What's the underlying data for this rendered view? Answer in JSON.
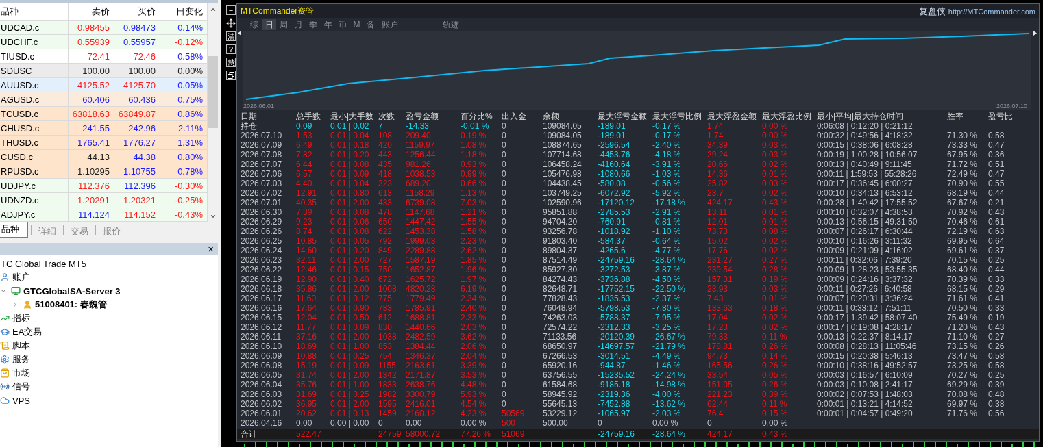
{
  "market_watch": {
    "columns": [
      "品种",
      "卖价",
      "买价",
      "日变化"
    ],
    "rows": [
      {
        "symbol": "UDCAD.c",
        "color": "#effbef",
        "bid": {
          "value": "0.98455",
          "kind": "down"
        },
        "ask": {
          "value": "0.98473",
          "kind": "up"
        },
        "change": {
          "value": "0.14%",
          "kind": "up"
        }
      },
      {
        "symbol": "UDCHF.c",
        "color": "#effbef",
        "bid": {
          "value": "0.55939",
          "kind": "down"
        },
        "ask": {
          "value": "0.55957",
          "kind": "up"
        },
        "change": {
          "value": "-0.12%",
          "kind": "down"
        }
      },
      {
        "symbol": "TIUSD.c",
        "color": "#ffffff",
        "bid": {
          "value": "72.41",
          "kind": "down"
        },
        "ask": {
          "value": "72.46",
          "kind": "down"
        },
        "change": {
          "value": "0.58%",
          "kind": "up"
        }
      },
      {
        "symbol": "SDUSC",
        "color": "#ebebeb",
        "bid": {
          "value": "100.00",
          "kind": "flat"
        },
        "ask": {
          "value": "100.00",
          "kind": "flat"
        },
        "change": {
          "value": "0.00%",
          "kind": "flat"
        }
      },
      {
        "symbol": "AUUSD.c",
        "color": "#e3effb",
        "bid": {
          "value": "4125.52",
          "kind": "down"
        },
        "ask": {
          "value": "4125.70",
          "kind": "down"
        },
        "change": {
          "value": "0.05%",
          "kind": "up"
        }
      },
      {
        "symbol": "AGUSD.c",
        "color": "#fbebdc",
        "bid": {
          "value": "60.406",
          "kind": "up"
        },
        "ask": {
          "value": "60.436",
          "kind": "up"
        },
        "change": {
          "value": "0.75%",
          "kind": "up"
        }
      },
      {
        "symbol": "TCUSD.c",
        "color": "#fde4ca",
        "bid": {
          "value": "63818.63",
          "kind": "down"
        },
        "ask": {
          "value": "63849.87",
          "kind": "down"
        },
        "change": {
          "value": "0.86%",
          "kind": "up"
        }
      },
      {
        "symbol": "CHUSD.c",
        "color": "#fde4ca",
        "bid": {
          "value": "241.55",
          "kind": "up"
        },
        "ask": {
          "value": "242.96",
          "kind": "up"
        },
        "change": {
          "value": "2.11%",
          "kind": "up"
        }
      },
      {
        "symbol": "THUSD.c",
        "color": "#fde4ca",
        "bid": {
          "value": "1765.41",
          "kind": "up"
        },
        "ask": {
          "value": "1776.27",
          "kind": "up"
        },
        "change": {
          "value": "1.31%",
          "kind": "up"
        }
      },
      {
        "symbol": "CUSD.c",
        "color": "#fde4ca",
        "bid": {
          "value": "44.13",
          "kind": "flat"
        },
        "ask": {
          "value": "44.38",
          "kind": "up"
        },
        "change": {
          "value": "0.80%",
          "kind": "up"
        }
      },
      {
        "symbol": "RPUSD.c",
        "color": "#fde4ca",
        "bid": {
          "value": "1.10295",
          "kind": "flat"
        },
        "ask": {
          "value": "1.10755",
          "kind": "up"
        },
        "change": {
          "value": "0.78%",
          "kind": "up"
        }
      },
      {
        "symbol": "UDJPY.c",
        "color": "#effbef",
        "bid": {
          "value": "112.376",
          "kind": "down"
        },
        "ask": {
          "value": "112.396",
          "kind": "up"
        },
        "change": {
          "value": "-0.30%",
          "kind": "down"
        }
      },
      {
        "symbol": "UDNZD.c",
        "color": "#effbef",
        "bid": {
          "value": "1.20291",
          "kind": "down"
        },
        "ask": {
          "value": "1.20321",
          "kind": "down"
        },
        "change": {
          "value": "-0.25%",
          "kind": "down"
        }
      },
      {
        "symbol": "ADJPY.c",
        "color": "#effbef",
        "bid": {
          "value": "114.124",
          "kind": "up"
        },
        "ask": {
          "value": "114.152",
          "kind": "down"
        },
        "change": {
          "value": "-0.43%",
          "kind": "down"
        }
      }
    ],
    "tabs": [
      {
        "label": "品种",
        "selected": true
      },
      {
        "label": "详细",
        "selected": false
      },
      {
        "label": "交易",
        "selected": false
      },
      {
        "label": "报价",
        "selected": false
      }
    ]
  },
  "navigator": {
    "close": "×",
    "tree": [
      {
        "label": "TC Global Trade MT5",
        "children": [
          {
            "label": "账户",
            "kind": "accounts",
            "children": [
              {
                "label": "GTCGlobalSA-Server 3",
                "kind": "server",
                "expanded": true,
                "children": [
                  {
                    "label": "51008401: 春魏管",
                    "kind": "account",
                    "expanded": false
                  }
                ]
              }
            ]
          },
          {
            "label": "指标",
            "kind": "indicators"
          },
          {
            "label": "EA交易",
            "kind": "experts"
          },
          {
            "label": "脚本",
            "kind": "scripts"
          },
          {
            "label": "服务",
            "kind": "services"
          },
          {
            "label": "市场",
            "kind": "market"
          },
          {
            "label": "信号",
            "kind": "signals"
          },
          {
            "label": "VPS",
            "kind": "vps"
          }
        ]
      }
    ]
  },
  "commander": {
    "tools": [
      {
        "kind": "minimize",
        "label": "−"
      },
      {
        "kind": "move"
      },
      {
        "kind": "text",
        "label": "清"
      },
      {
        "kind": "help",
        "label": "?"
      },
      {
        "kind": "text",
        "label": "慧"
      },
      {
        "kind": "restore"
      }
    ],
    "title": "MTCommander资管",
    "brand": "复盘侠",
    "url": "http://MTCommander.com",
    "tabs": [
      {
        "label": "综",
        "selected": false
      },
      {
        "label": "日",
        "selected": true
      },
      {
        "label": "周",
        "selected": false
      },
      {
        "label": "月",
        "selected": false
      },
      {
        "label": "季",
        "selected": false
      },
      {
        "label": "年",
        "selected": false
      },
      {
        "label": "币",
        "selected": false
      },
      {
        "label": "M",
        "selected": false
      },
      {
        "label": "备",
        "selected": false
      },
      {
        "label": "账户",
        "selected": false
      }
    ],
    "mode_tabs": [
      {
        "label": "轨迹",
        "selected": false
      }
    ],
    "chart": {
      "start_label": "2026.06.01",
      "end_label": "2026.07.10"
    },
    "table": {
      "columns": [
        {
          "label": "日期",
          "kind": "date"
        },
        {
          "label": "总手数",
          "kind": "trade"
        },
        {
          "label": "最小|大手数",
          "kind": "trade"
        },
        {
          "label": "次数",
          "kind": "trade"
        },
        {
          "label": "盈亏金额",
          "kind": "trade"
        },
        {
          "label": "百分比%",
          "kind": "trade"
        },
        {
          "label": "出入金",
          "kind": "cash"
        },
        {
          "label": "余额",
          "kind": "balance"
        },
        {
          "label": "最大浮亏金额",
          "kind": "drawdown"
        },
        {
          "label": "最大浮亏比例",
          "kind": "drawdown"
        },
        {
          "label": "最大浮盈金额",
          "kind": "runup"
        },
        {
          "label": "最大浮盈比例",
          "kind": "runup"
        },
        {
          "label": "最小|平均|最大持仓时间",
          "kind": "stat"
        },
        {
          "label": "胜率",
          "kind": "stat"
        },
        {
          "label": "盈亏比",
          "kind": "stat"
        }
      ],
      "rows": [
        {
          "kind": "open",
          "cash_flow": false,
          "cells": [
            "持仓",
            "0.09",
            "0.01 | 0.02",
            "7",
            "-14.33",
            "-0.01 %",
            "0",
            "109084.05",
            "-189.01",
            "-0.17 %",
            "1.74",
            "0.00 %",
            "0:06:08 | 0:12:20 | 0:21:12",
            null,
            null
          ]
        },
        {
          "kind": "gain",
          "cash_flow": false,
          "cells": [
            "2026.07.10",
            "1.53",
            "0.01 | 0.04",
            "108",
            "209.40",
            "0.19 %",
            "0",
            "109084.05",
            "-189.01",
            "-0.17 %",
            "1.74",
            "0.00 %",
            "0:00:32 | 0:49:56 | 4:18:32",
            "71.30 %",
            "0.58"
          ]
        },
        {
          "kind": "gain",
          "cash_flow": false,
          "cells": [
            "2026.07.09",
            "6.49",
            "0.01 | 0.18",
            "420",
            "1159.97",
            "1.08 %",
            "0",
            "108874.65",
            "-2596.54",
            "-2.40 %",
            "34.39",
            "0.03 %",
            "0:00:15 | 0:38:06 | 6:08:28",
            "73.33 %",
            "0.47"
          ]
        },
        {
          "kind": "gain",
          "cash_flow": false,
          "cells": [
            "2026.07.08",
            "7.82",
            "0.01 | 0.20",
            "443",
            "1256.44",
            "1.18 %",
            "0",
            "107714.68",
            "-4453.76",
            "-4.18 %",
            "29.24",
            "0.03 %",
            "0:00:19 | 1:00:28 | 10:56:07",
            "67.95 %",
            "0.36"
          ]
        },
        {
          "kind": "gain",
          "cash_flow": false,
          "cells": [
            "2026.07.07",
            "6.44",
            "0.01 | 0.08",
            "435",
            "981.26",
            "0.93 %",
            "0",
            "106458.24",
            "-4160.64",
            "-3.91 %",
            "20.66",
            "0.02 %",
            "0:00:13 | 0:40:49 | 9:11:45",
            "71.72 %",
            "0.51"
          ]
        },
        {
          "kind": "gain",
          "cash_flow": false,
          "cells": [
            "2026.07.06",
            "6.57",
            "0.01 | 0.09",
            "418",
            "1038.53",
            "0.99 %",
            "0",
            "105476.98",
            "-1080.66",
            "-1.03 %",
            "14.36",
            "0.01 %",
            "0:00:11 | 1:59:53 | 55:28:26",
            "72.49 %",
            "0.47"
          ]
        },
        {
          "kind": "gain",
          "cash_flow": false,
          "cells": [
            "2026.07.03",
            "4.40",
            "0.01 | 0.04",
            "323",
            "689.20",
            "0.66 %",
            "0",
            "104438.45",
            "-580.08",
            "-0.56 %",
            "25.82",
            "0.03 %",
            "0:00:17 | 0:36:45 | 6:00:27",
            "70.90 %",
            "0.55"
          ]
        },
        {
          "kind": "gain",
          "cash_flow": false,
          "cells": [
            "2026.07.02",
            "12.91",
            "0.01 | 0.80",
            "613",
            "1158.29",
            "1.13 %",
            "0",
            "103749.25",
            "-6072.92",
            "-5.92 %",
            "23.7",
            "0.02 %",
            "0:00:10 | 0:34:13 | 6:53:12",
            "68.19 %",
            "0.44"
          ]
        },
        {
          "kind": "gain",
          "cash_flow": false,
          "cells": [
            "2026.07.01",
            "40.35",
            "0.01 | 2.00",
            "433",
            "6739.08",
            "7.03 %",
            "0",
            "102590.96",
            "-17120.12",
            "-17.18 %",
            "424.17",
            "0.43 %",
            "0:00:28 | 1:40:42 | 17:55:52",
            "67.67 %",
            "0.21"
          ]
        },
        {
          "kind": "gain",
          "cash_flow": false,
          "cells": [
            "2026.06.30",
            "7.39",
            "0.01 | 0.08",
            "478",
            "1147.68",
            "1.21 %",
            "0",
            "95851.88",
            "-2785.53",
            "-2.91 %",
            "13.11",
            "0.01 %",
            "0:00:10 | 0:32:07 | 4:38:53",
            "70.92 %",
            "0.43"
          ]
        },
        {
          "kind": "gain",
          "cash_flow": false,
          "cells": [
            "2026.06.29",
            "9.23",
            "0.01 | 0.06",
            "650",
            "1447.42",
            "1.55 %",
            "0",
            "94704.20",
            "-760.91",
            "-0.81 %",
            "12.01",
            "0.01 %",
            "0:00:13 | 0:56:15 | 49:31:50",
            "70.46 %",
            "0.61"
          ]
        },
        {
          "kind": "gain",
          "cash_flow": false,
          "cells": [
            "2026.06.26",
            "8.74",
            "0.01 | 0.08",
            "622",
            "1453.38",
            "1.58 %",
            "0",
            "93256.78",
            "-1018.92",
            "-1.10 %",
            "73.73",
            "0.08 %",
            "0:00:07 | 0:26:17 | 6:30:44",
            "72.19 %",
            "0.63"
          ]
        },
        {
          "kind": "gain",
          "cash_flow": false,
          "cells": [
            "2026.06.25",
            "10.85",
            "0.01 | 0.05",
            "792",
            "1999.03",
            "2.23 %",
            "0",
            "91803.40",
            "-584.37",
            "-0.64 %",
            "15.02",
            "0.02 %",
            "0:00:10 | 0:16:26 | 3:11:32",
            "69.95 %",
            "0.64"
          ]
        },
        {
          "kind": "gain",
          "cash_flow": false,
          "cells": [
            "2026.06.24",
            "14.60",
            "0.01 | 0.20",
            "849",
            "2289.88",
            "2.62 %",
            "0",
            "89804.37",
            "-4265.6",
            "-4.77 %",
            "17.76",
            "0.02 %",
            "0:00:09 | 0:21:09 | 4:16:02",
            "69.61 %",
            "0.37"
          ]
        },
        {
          "kind": "gain",
          "cash_flow": false,
          "cells": [
            "2026.06.23",
            "32.11",
            "0.01 | 2.00",
            "727",
            "1587.19",
            "1.85 %",
            "0",
            "87514.49",
            "-24759.16",
            "-28.64 %",
            "231.27",
            "0.27 %",
            "0:00:11 | 0:32:06 | 7:39:20",
            "70.15 %",
            "0.25"
          ]
        },
        {
          "kind": "gain",
          "cash_flow": false,
          "cells": [
            "2026.06.22",
            "12.46",
            "0.01 | 0.15",
            "750",
            "1652.87",
            "1.96 %",
            "0",
            "85927.30",
            "-3272.53",
            "-3.87 %",
            "239.54",
            "0.28 %",
            "0:00:09 | 1:28:23 | 53:55:35",
            "68.40 %",
            "0.44"
          ]
        },
        {
          "kind": "gain",
          "cash_flow": false,
          "cells": [
            "2026.06.19",
            "12.90",
            "0.01 | 0.40",
            "672",
            "1625.72",
            "1.97 %",
            "0",
            "84274.43",
            "-3736.88",
            "-4.50 %",
            "157.31",
            "0.19 %",
            "0:00:09 | 0:24:16 | 3:37:32",
            "70.39 %",
            "0.33"
          ]
        },
        {
          "kind": "gain",
          "cash_flow": false,
          "cells": [
            "2026.06.18",
            "35.86",
            "0.01 | 2.00",
            "1008",
            "4820.28",
            "6.19 %",
            "0",
            "82648.71",
            "-17752.15",
            "-22.50 %",
            "23.93",
            "0.03 %",
            "0:00:11 | 0:27:26 | 6:40:58",
            "68.15 %",
            "0.29"
          ]
        },
        {
          "kind": "gain",
          "cash_flow": false,
          "cells": [
            "2026.06.17",
            "11.60",
            "0.01 | 0.12",
            "775",
            "1779.49",
            "2.34 %",
            "0",
            "77828.43",
            "-1835.53",
            "-2.37 %",
            "7.43",
            "0.01 %",
            "0:00:07 | 0:20:31 | 3:36:24",
            "71.61 %",
            "0.41"
          ]
        },
        {
          "kind": "gain",
          "cash_flow": false,
          "cells": [
            "2026.06.16",
            "17.64",
            "0.01 | 0.90",
            "783",
            "1785.91",
            "2.40 %",
            "0",
            "76048.94",
            "-5798.53",
            "-7.80 %",
            "133.63",
            "0.18 %",
            "0:00:11 | 0:33:12 | 7:51:11",
            "70.50 %",
            "0.33"
          ]
        },
        {
          "kind": "gain",
          "cash_flow": false,
          "cells": [
            "2026.06.15",
            "12.04",
            "0.01 | 0.50",
            "612",
            "1688.81",
            "2.33 %",
            "0",
            "74263.03",
            "-5788.37",
            "-7.95 %",
            "17.04",
            "0.02 %",
            "0:00:17 | 1:39:42 | 58:07:40",
            "75.49 %",
            "0.19"
          ]
        },
        {
          "kind": "gain",
          "cash_flow": false,
          "cells": [
            "2026.06.12",
            "11.77",
            "0.01 | 0.09",
            "830",
            "1440.66",
            "2.03 %",
            "0",
            "72574.22",
            "-2312.33",
            "-3.25 %",
            "17.23",
            "0.02 %",
            "0:00:17 | 0:19:08 | 4:28:17",
            "71.20 %",
            "0.43"
          ]
        },
        {
          "kind": "gain",
          "cash_flow": false,
          "cells": [
            "2026.06.11",
            "37.16",
            "0.01 | 2.00",
            "1038",
            "2482.59",
            "3.62 %",
            "0",
            "71133.56",
            "-20120.39",
            "-26.67 %",
            "79.33",
            "0.11 %",
            "0:00:13 | 0:22:37 | 8:14:17",
            "71.10 %",
            "0.27"
          ]
        },
        {
          "kind": "gain",
          "cash_flow": false,
          "cells": [
            "2026.06.10",
            "18.69",
            "0.01 | 1.00",
            "853",
            "1384.44",
            "2.06 %",
            "0",
            "68650.97",
            "-14697.57",
            "-21.79 %",
            "178.81",
            "0.26 %",
            "0:00:08 | 0:28:13 | 11:05:46",
            "73.15 %",
            "0.26"
          ]
        },
        {
          "kind": "gain",
          "cash_flow": false,
          "cells": [
            "2026.06.09",
            "10.88",
            "0.01 | 0.25",
            "754",
            "1346.37",
            "2.04 %",
            "0",
            "67266.53",
            "-3014.51",
            "-4.49 %",
            "94.73",
            "0.14 %",
            "0:00:15 | 0:20:38 | 5:46:13",
            "73.47 %",
            "0.58"
          ]
        },
        {
          "kind": "gain",
          "cash_flow": false,
          "cells": [
            "2026.06.08",
            "15.19",
            "0.01 | 0.09",
            "1155",
            "2163.61",
            "3.39 %",
            "0",
            "65920.16",
            "-944.87",
            "-1.46 %",
            "165.56",
            "0.26 %",
            "0:00:10 | 0:38:16 | 49:52:57",
            "73.25 %",
            "0.58"
          ]
        },
        {
          "kind": "gain",
          "cash_flow": false,
          "cells": [
            "2026.06.05",
            "31.74",
            "0.01 | 2.00",
            "1342",
            "2171.87",
            "3.53 %",
            "0",
            "63756.55",
            "-15235.52",
            "-24.24 %",
            "33.54",
            "0.05 %",
            "0:00:03 | 0:16:57 | 6:10:09",
            "70.27 %",
            "0.25"
          ]
        },
        {
          "kind": "gain",
          "cash_flow": false,
          "cells": [
            "2026.06.04",
            "35.76",
            "0.01 | 1.00",
            "1833",
            "2638.76",
            "4.48 %",
            "0",
            "61584.68",
            "-9185.18",
            "-14.98 %",
            "151.05",
            "0.26 %",
            "0:00:03 | 0:10:08 | 2:41:17",
            "69.29 %",
            "0.39"
          ]
        },
        {
          "kind": "gain",
          "cash_flow": false,
          "cells": [
            "2026.06.03",
            "31.69",
            "0.01 | 0.25",
            "1982",
            "3300.79",
            "5.93 %",
            "0",
            "58945.92",
            "-2319.36",
            "-4.00 %",
            "221.23",
            "0.39 %",
            "0:00:02 | 0:07:53 | 1:48:03",
            "70.08 %",
            "0.48"
          ]
        },
        {
          "kind": "gain",
          "cash_flow": false,
          "cells": [
            "2026.06.02",
            "36.95",
            "0.01 | 2.00",
            "1595",
            "2416.01",
            "4.54 %",
            "0",
            "55645.13",
            "-7452.88",
            "-13.62 %",
            "62.44",
            "0.11 %",
            "0:00:01 | 0:13:21 | 4:14:52",
            "69.97 %",
            "0.38"
          ]
        },
        {
          "kind": "gain",
          "cash_flow": true,
          "cells": [
            "2026.06.01",
            "20.62",
            "0.01 | 0.13",
            "1459",
            "2160.12",
            "4.23 %",
            "50569",
            "53229.12",
            "-1065.97",
            "-2.03 %",
            "76.4",
            "0.15 %",
            "0:00:01 | 0:04:57 | 0:49:20",
            "71.76 %",
            "0.56"
          ]
        },
        {
          "kind": "flat",
          "cash_flow": true,
          "cells": [
            "2026.04.16",
            "0.00",
            "0.00 | 0.00",
            "0",
            "0.00",
            "0.00 %",
            "500",
            "500.00",
            "0",
            "0.00 %",
            "0",
            "0.00 %",
            null,
            null,
            null
          ]
        },
        {
          "kind": "total",
          "cash_flow": true,
          "cells": [
            "合计",
            "522.47",
            null,
            "24759",
            "58000.72",
            "77.26 %",
            "51069",
            null,
            "-24759.16",
            "-28.64 %",
            "424.17",
            "0.43 %",
            null,
            null,
            null
          ]
        }
      ]
    }
  }
}
